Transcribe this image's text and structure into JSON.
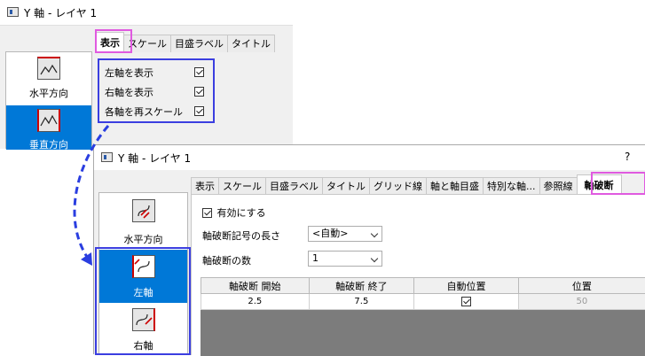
{
  "dialog1": {
    "title": "Y 軸 - レイヤ 1",
    "tabs": [
      "表示",
      "スケール",
      "目盛ラベル",
      "タイトル"
    ],
    "side_items": [
      "水平方向",
      "垂直方向"
    ],
    "options": [
      {
        "label": "左軸を表示",
        "checked": true
      },
      {
        "label": "右軸を表示",
        "checked": true
      },
      {
        "label": "各軸を再スケール",
        "checked": true
      }
    ]
  },
  "dialog2": {
    "title": "Y 軸 - レイヤ 1",
    "help": "?",
    "tabs": [
      "表示",
      "スケール",
      "目盛ラベル",
      "タイトル",
      "グリッド線",
      "軸と軸目盛",
      "特別な軸...",
      "参照線",
      "軸破断"
    ],
    "side_items": [
      "水平方向",
      "左軸",
      "右軸"
    ],
    "enable_label": "有効にする",
    "length_label": "軸破断記号の長さ",
    "length_value": "<自動>",
    "count_label": "軸破断の数",
    "count_value": "1",
    "table": {
      "headers": [
        "軸破断 開始",
        "軸破断 終了",
        "自動位置",
        "位置"
      ],
      "rows": [
        {
          "start": "2.5",
          "end": "7.5",
          "auto": true,
          "position": "50"
        }
      ]
    }
  },
  "colors": {
    "highlight_box": "#e05ae0",
    "focus_box": "#3b3ee0",
    "selection": "#0078d7",
    "arrow": "#2a3ee0"
  }
}
